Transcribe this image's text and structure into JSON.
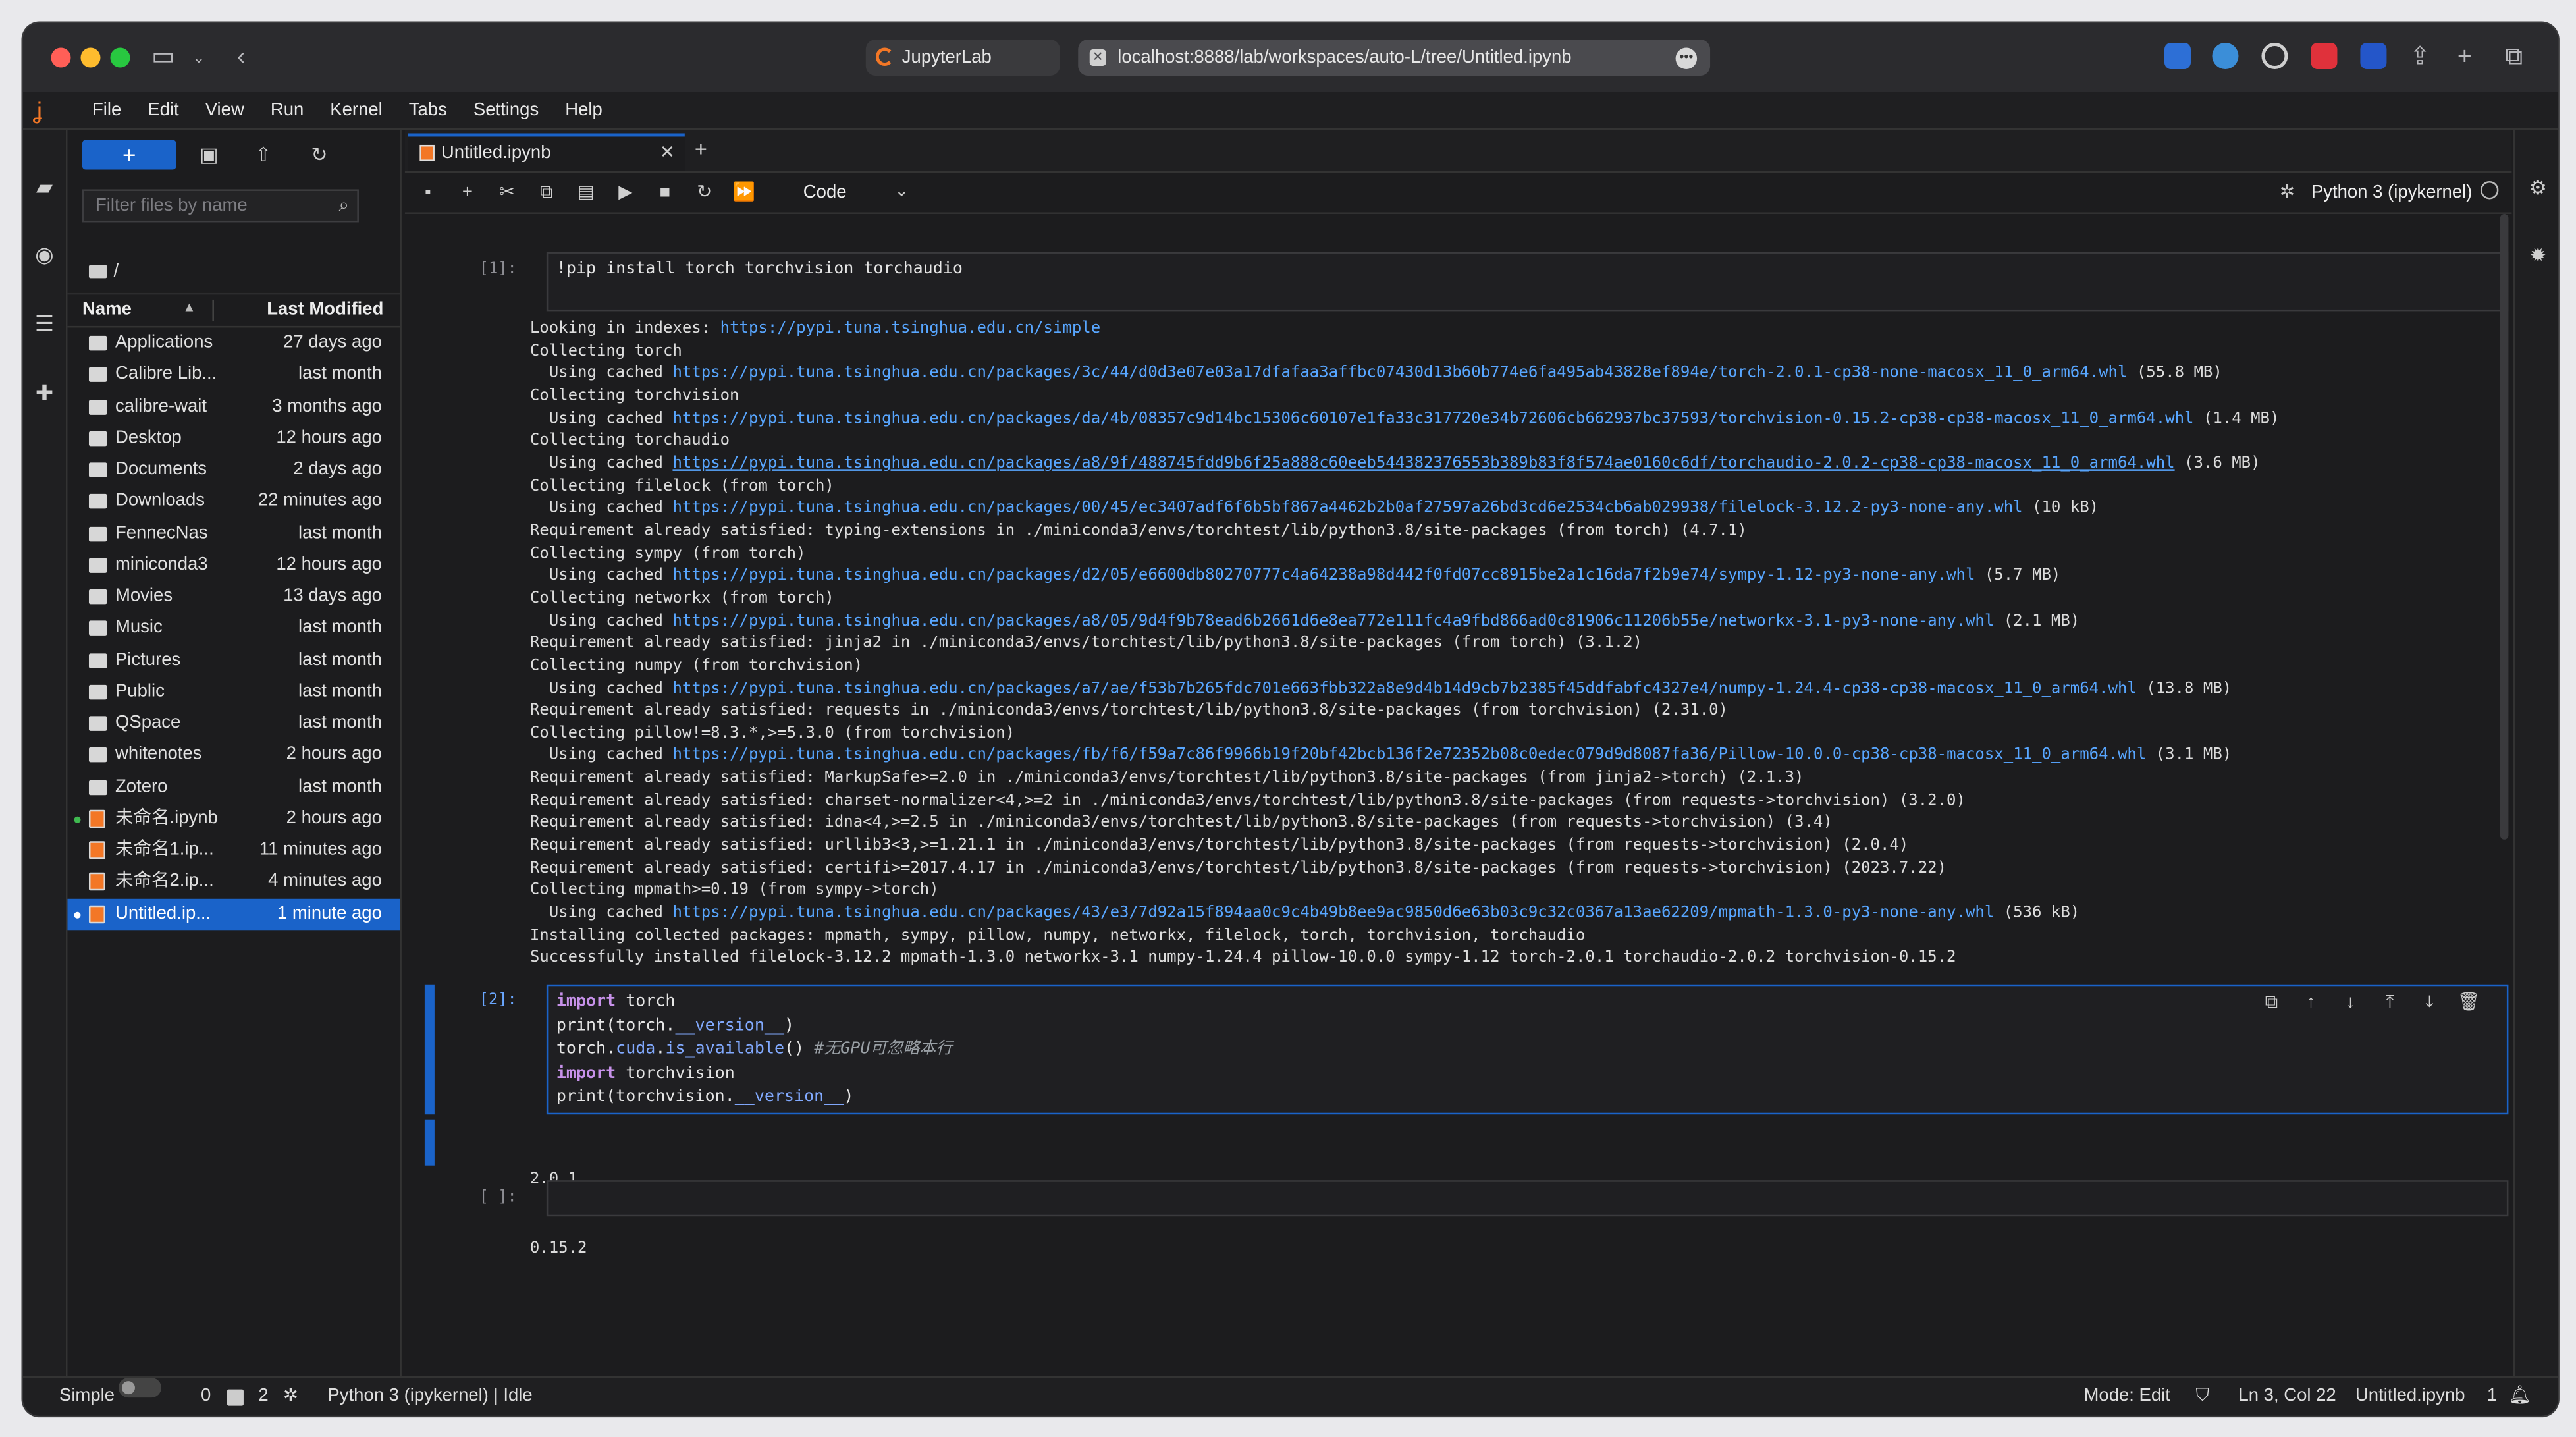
{
  "browser": {
    "tab_title": "JupyterLab",
    "url": "localhost:8888/lab/workspaces/auto-L/tree/Untitled.ipynb"
  },
  "menu": [
    "File",
    "Edit",
    "View",
    "Run",
    "Kernel",
    "Tabs",
    "Settings",
    "Help"
  ],
  "filebrowser": {
    "new_label": "+",
    "filter_placeholder": "Filter files by name",
    "path": "/",
    "col_name": "Name",
    "col_modified": "Last Modified",
    "rows": [
      {
        "name": "Applications",
        "date": "27 days ago",
        "type": "folder"
      },
      {
        "name": "Calibre Lib...",
        "date": "last month",
        "type": "folder"
      },
      {
        "name": "calibre-wait",
        "date": "3 months ago",
        "type": "folder"
      },
      {
        "name": "Desktop",
        "date": "12 hours ago",
        "type": "folder"
      },
      {
        "name": "Documents",
        "date": "2 days ago",
        "type": "folder"
      },
      {
        "name": "Downloads",
        "date": "22 minutes ago",
        "type": "folder"
      },
      {
        "name": "FennecNas",
        "date": "last month",
        "type": "folder"
      },
      {
        "name": "miniconda3",
        "date": "12 hours ago",
        "type": "folder"
      },
      {
        "name": "Movies",
        "date": "13 days ago",
        "type": "folder"
      },
      {
        "name": "Music",
        "date": "last month",
        "type": "folder"
      },
      {
        "name": "Pictures",
        "date": "last month",
        "type": "folder"
      },
      {
        "name": "Public",
        "date": "last month",
        "type": "folder"
      },
      {
        "name": "QSpace",
        "date": "last month",
        "type": "folder"
      },
      {
        "name": "whitenotes",
        "date": "2 hours ago",
        "type": "folder"
      },
      {
        "name": "Zotero",
        "date": "last month",
        "type": "folder"
      },
      {
        "name": "未命名.ipynb",
        "date": "2 hours ago",
        "type": "notebook"
      },
      {
        "name": "未命名1.ip...",
        "date": "11 minutes ago",
        "type": "notebook"
      },
      {
        "name": "未命名2.ip...",
        "date": "4 minutes ago",
        "type": "notebook"
      },
      {
        "name": "Untitled.ip...",
        "date": "1 minute ago",
        "type": "notebook"
      }
    ]
  },
  "notebook": {
    "tab_title": "Untitled.ipynb",
    "cell_type": "Code",
    "kernel": "Python 3 (ipykernel)",
    "cells": [
      {
        "prompt": "[1]:",
        "source": "!pip install torch torchvision torchaudio",
        "output": [
          {
            "text": "Looking in indexes: ",
            "link": "https://pypi.tuna.tsinghua.edu.cn/simple",
            "tail": ""
          },
          {
            "text": "Collecting torch",
            "link": "",
            "tail": ""
          },
          {
            "text": "  Using cached ",
            "link": "https://pypi.tuna.tsinghua.edu.cn/packages/3c/44/d0d3e07e03a17dfafaa3affbc07430d13b60b774e6fa495ab43828ef894e/torch-2.0.1-cp38-none-macosx_11_0_arm64.whl",
            "tail": " (55.8 MB)"
          },
          {
            "text": "Collecting torchvision",
            "link": "",
            "tail": ""
          },
          {
            "text": "  Using cached ",
            "link": "https://pypi.tuna.tsinghua.edu.cn/packages/da/4b/08357c9d14bc15306c60107e1fa33c317720e34b72606cb662937bc37593/torchvision-0.15.2-cp38-cp38-macosx_11_0_arm64.whl",
            "tail": " (1.4 MB)"
          },
          {
            "text": "Collecting torchaudio",
            "link": "",
            "tail": ""
          },
          {
            "text": "  Using cached ",
            "link": "https://pypi.tuna.tsinghua.edu.cn/packages/a8/9f/488745fdd9b6f25a888c60eeb544382376553b389b83f8f574ae0160c6df/torchaudio-2.0.2-cp38-cp38-macosx_11_0_arm64.whl",
            "tail": " (3.6 MB)",
            "underline": true
          },
          {
            "text": "Collecting filelock (from torch)",
            "link": "",
            "tail": ""
          },
          {
            "text": "  Using cached ",
            "link": "https://pypi.tuna.tsinghua.edu.cn/packages/00/45/ec3407adf6f6b5bf867a4462b2b0af27597a26bd3cd6e2534cb6ab029938/filelock-3.12.2-py3-none-any.whl",
            "tail": " (10 kB)"
          },
          {
            "text": "Requirement already satisfied: typing-extensions in ./miniconda3/envs/torchtest/lib/python3.8/site-packages (from torch) (4.7.1)",
            "link": "",
            "tail": ""
          },
          {
            "text": "Collecting sympy (from torch)",
            "link": "",
            "tail": ""
          },
          {
            "text": "  Using cached ",
            "link": "https://pypi.tuna.tsinghua.edu.cn/packages/d2/05/e6600db80270777c4a64238a98d442f0fd07cc8915be2a1c16da7f2b9e74/sympy-1.12-py3-none-any.whl",
            "tail": " (5.7 MB)"
          },
          {
            "text": "Collecting networkx (from torch)",
            "link": "",
            "tail": ""
          },
          {
            "text": "  Using cached ",
            "link": "https://pypi.tuna.tsinghua.edu.cn/packages/a8/05/9d4f9b78ead6b2661d6e8ea772e111fc4a9fbd866ad0c81906c11206b55e/networkx-3.1-py3-none-any.whl",
            "tail": " (2.1 MB)"
          },
          {
            "text": "Requirement already satisfied: jinja2 in ./miniconda3/envs/torchtest/lib/python3.8/site-packages (from torch) (3.1.2)",
            "link": "",
            "tail": ""
          },
          {
            "text": "Collecting numpy (from torchvision)",
            "link": "",
            "tail": ""
          },
          {
            "text": "  Using cached ",
            "link": "https://pypi.tuna.tsinghua.edu.cn/packages/a7/ae/f53b7b265fdc701e663fbb322a8e9d4b14d9cb7b2385f45ddfabfc4327e4/numpy-1.24.4-cp38-cp38-macosx_11_0_arm64.whl",
            "tail": " (13.8 MB)"
          },
          {
            "text": "Requirement already satisfied: requests in ./miniconda3/envs/torchtest/lib/python3.8/site-packages (from torchvision) (2.31.0)",
            "link": "",
            "tail": ""
          },
          {
            "text": "Collecting pillow!=8.3.*,>=5.3.0 (from torchvision)",
            "link": "",
            "tail": ""
          },
          {
            "text": "  Using cached ",
            "link": "https://pypi.tuna.tsinghua.edu.cn/packages/fb/f6/f59a7c86f9966b19f20bf42bcb136f2e72352b08c0edec079d9d8087fa36/Pillow-10.0.0-cp38-cp38-macosx_11_0_arm64.whl",
            "tail": " (3.1 MB)"
          },
          {
            "text": "Requirement already satisfied: MarkupSafe>=2.0 in ./miniconda3/envs/torchtest/lib/python3.8/site-packages (from jinja2->torch) (2.1.3)",
            "link": "",
            "tail": ""
          },
          {
            "text": "Requirement already satisfied: charset-normalizer<4,>=2 in ./miniconda3/envs/torchtest/lib/python3.8/site-packages (from requests->torchvision) (3.2.0)",
            "link": "",
            "tail": ""
          },
          {
            "text": "Requirement already satisfied: idna<4,>=2.5 in ./miniconda3/envs/torchtest/lib/python3.8/site-packages (from requests->torchvision) (3.4)",
            "link": "",
            "tail": ""
          },
          {
            "text": "Requirement already satisfied: urllib3<3,>=1.21.1 in ./miniconda3/envs/torchtest/lib/python3.8/site-packages (from requests->torchvision) (2.0.4)",
            "link": "",
            "tail": ""
          },
          {
            "text": "Requirement already satisfied: certifi>=2017.4.17 in ./miniconda3/envs/torchtest/lib/python3.8/site-packages (from requests->torchvision) (2023.7.22)",
            "link": "",
            "tail": ""
          },
          {
            "text": "Collecting mpmath>=0.19 (from sympy->torch)",
            "link": "",
            "tail": ""
          },
          {
            "text": "  Using cached ",
            "link": "https://pypi.tuna.tsinghua.edu.cn/packages/43/e3/7d92a15f894aa0c9c4b49b8ee9ac9850d6e63b03c9c32c0367a13ae62209/mpmath-1.3.0-py3-none-any.whl",
            "tail": " (536 kB)"
          },
          {
            "text": "Installing collected packages: mpmath, sympy, pillow, numpy, networkx, filelock, torch, torchvision, torchaudio",
            "link": "",
            "tail": ""
          },
          {
            "text": "Successfully installed filelock-3.12.2 mpmath-1.3.0 networkx-3.1 numpy-1.24.4 pillow-10.0.0 sympy-1.12 torch-2.0.1 torchaudio-2.0.2 torchvision-0.15.2",
            "link": "",
            "tail": ""
          }
        ]
      },
      {
        "prompt": "[2]:",
        "lines": [
          [
            {
              "t": "import",
              "c": "kw"
            },
            {
              "t": " torch",
              "c": ""
            }
          ],
          [
            {
              "t": "print(torch.",
              "c": ""
            },
            {
              "t": "__version__",
              "c": "fn"
            },
            {
              "t": ")",
              "c": ""
            }
          ],
          [
            {
              "t": "torch.",
              "c": ""
            },
            {
              "t": "cuda",
              "c": "fn"
            },
            {
              "t": ".",
              "c": ""
            },
            {
              "t": "is_available",
              "c": "fn"
            },
            {
              "t": "() ",
              "c": ""
            },
            {
              "t": "#无GPU可忽略本行",
              "c": "cm"
            }
          ],
          [
            {
              "t": "import",
              "c": "kw"
            },
            {
              "t": " torchvision",
              "c": ""
            }
          ],
          [
            {
              "t": "print(torchvision.",
              "c": ""
            },
            {
              "t": "__version__",
              "c": "fn"
            },
            {
              "t": ")",
              "c": ""
            }
          ]
        ],
        "output_lines": [
          "2.0.1",
          "0.15.2"
        ]
      },
      {
        "prompt": "[ ]:",
        "source": ""
      }
    ]
  },
  "status": {
    "mode_label": "Simple",
    "terminals": "0",
    "kernels": "2",
    "kernel_status": "Python 3 (ipykernel) | Idle",
    "mode": "Mode: Edit",
    "position": "Ln 3, Col 22",
    "filename": "Untitled.ipynb",
    "notifications": "1"
  },
  "colors": {
    "accent": "#1a63c9",
    "jupyter_orange": "#f37726",
    "link": "#58a6ff",
    "running": "#3fb950"
  }
}
